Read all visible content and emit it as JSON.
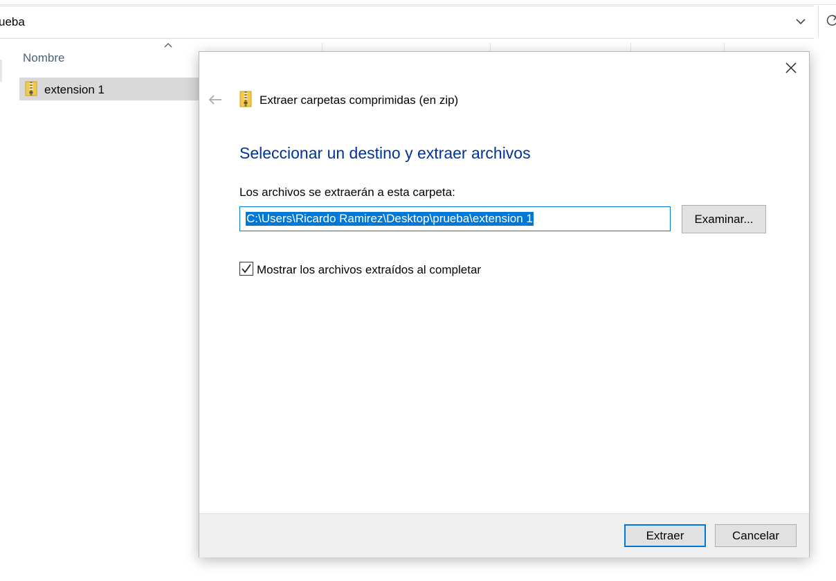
{
  "explorer": {
    "address_text": "ueba",
    "column_header": "Nombre",
    "file_name": "extension 1"
  },
  "dialog": {
    "title": "Extraer carpetas comprimidas (en zip)",
    "heading": "Seleccionar un destino y extraer archivos",
    "destination_label": "Los archivos se extraerán a esta carpeta:",
    "destination_path": "C:\\Users\\Ricardo Ramirez\\Desktop\\prueba\\extension 1",
    "browse_button": "Examinar...",
    "show_files_label": "Mostrar los archivos extraídos al completar",
    "show_files_checked": true,
    "extract_button": "Extraer",
    "cancel_button": "Cancelar"
  },
  "colors": {
    "heading": "#003399",
    "accent": "#0078d7",
    "footer_bg": "#f0f0f0",
    "selected_row": "#d9d9d9"
  },
  "icons": [
    "chevron-down-icon",
    "refresh-icon",
    "sort-up-icon",
    "zip-folder-icon",
    "close-icon",
    "back-arrow-icon",
    "check-icon"
  ]
}
